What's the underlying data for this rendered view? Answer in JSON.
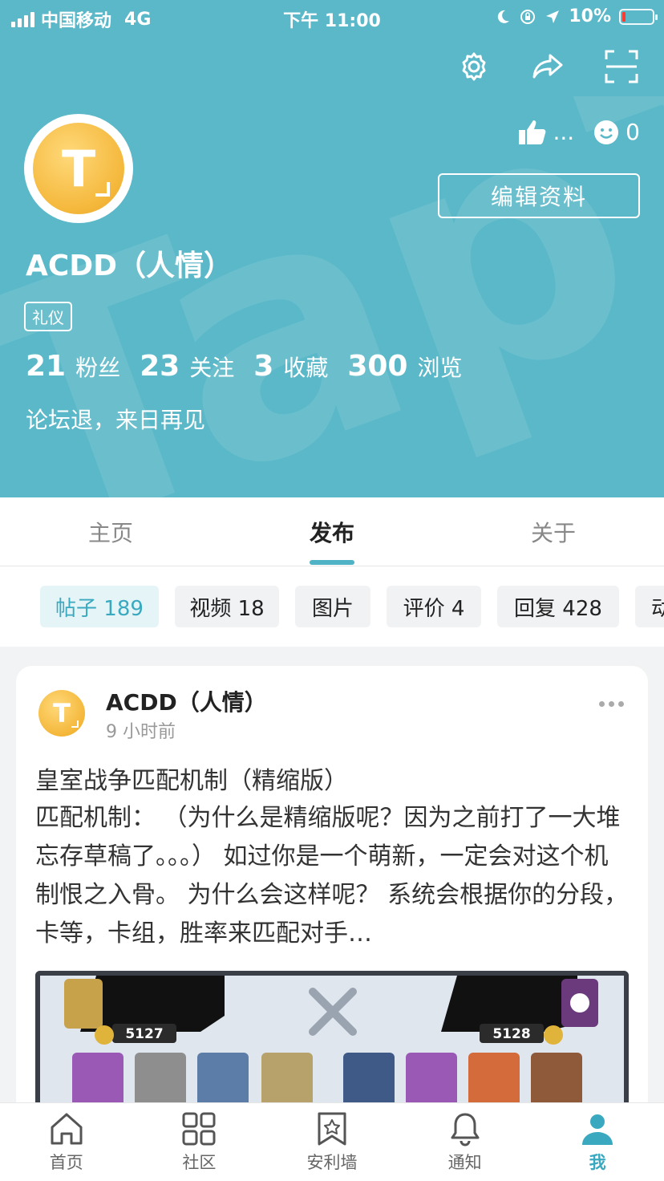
{
  "status_bar": {
    "carrier": "中国移动",
    "network": "4G",
    "time": "下午 11:00",
    "battery": "10%"
  },
  "profile": {
    "name": "ACDD（人情）",
    "likes": "...",
    "reactions": "0",
    "edit_label": "编辑资料",
    "tag": "礼仪",
    "stats": [
      {
        "num": "21",
        "label": "粉丝"
      },
      {
        "num": "23",
        "label": "关注"
      },
      {
        "num": "3",
        "label": "收藏"
      },
      {
        "num": "300",
        "label": "浏览"
      }
    ],
    "bio": "论坛退，来日再见"
  },
  "tabs": [
    "主页",
    "发布",
    "关于"
  ],
  "active_tab": "发布",
  "chips": [
    {
      "label": "帖子 189",
      "active": true
    },
    {
      "label": "视频 18"
    },
    {
      "label": "图片"
    },
    {
      "label": "评价 4"
    },
    {
      "label": "回复 428"
    },
    {
      "label": "动"
    }
  ],
  "post": {
    "author": "ACDD（人情）",
    "time": "9 小时前",
    "title": "皇室战争匹配机制（精缩版）",
    "body": "匹配机制： （为什么是精缩版呢？因为之前打了一大堆忘存草稿了。。。） 如过你是一个萌新，一定会对这个机制恨之入骨。 为什么会这样呢？ 系统会根据你的分段，卡等，卡组，胜率来匹配对手…",
    "image_scores": [
      "5127",
      "5128"
    ]
  },
  "bottom_nav": [
    {
      "label": "首页",
      "icon": "home-icon"
    },
    {
      "label": "社区",
      "icon": "grid-icon"
    },
    {
      "label": "安利墙",
      "icon": "star-bookmark-icon"
    },
    {
      "label": "通知",
      "icon": "bell-icon"
    },
    {
      "label": "我",
      "icon": "person-icon",
      "active": true
    }
  ],
  "colors": {
    "header_bg": "#5ab8c8",
    "accent": "#3aa9bf",
    "coin": "#f4b73a"
  }
}
